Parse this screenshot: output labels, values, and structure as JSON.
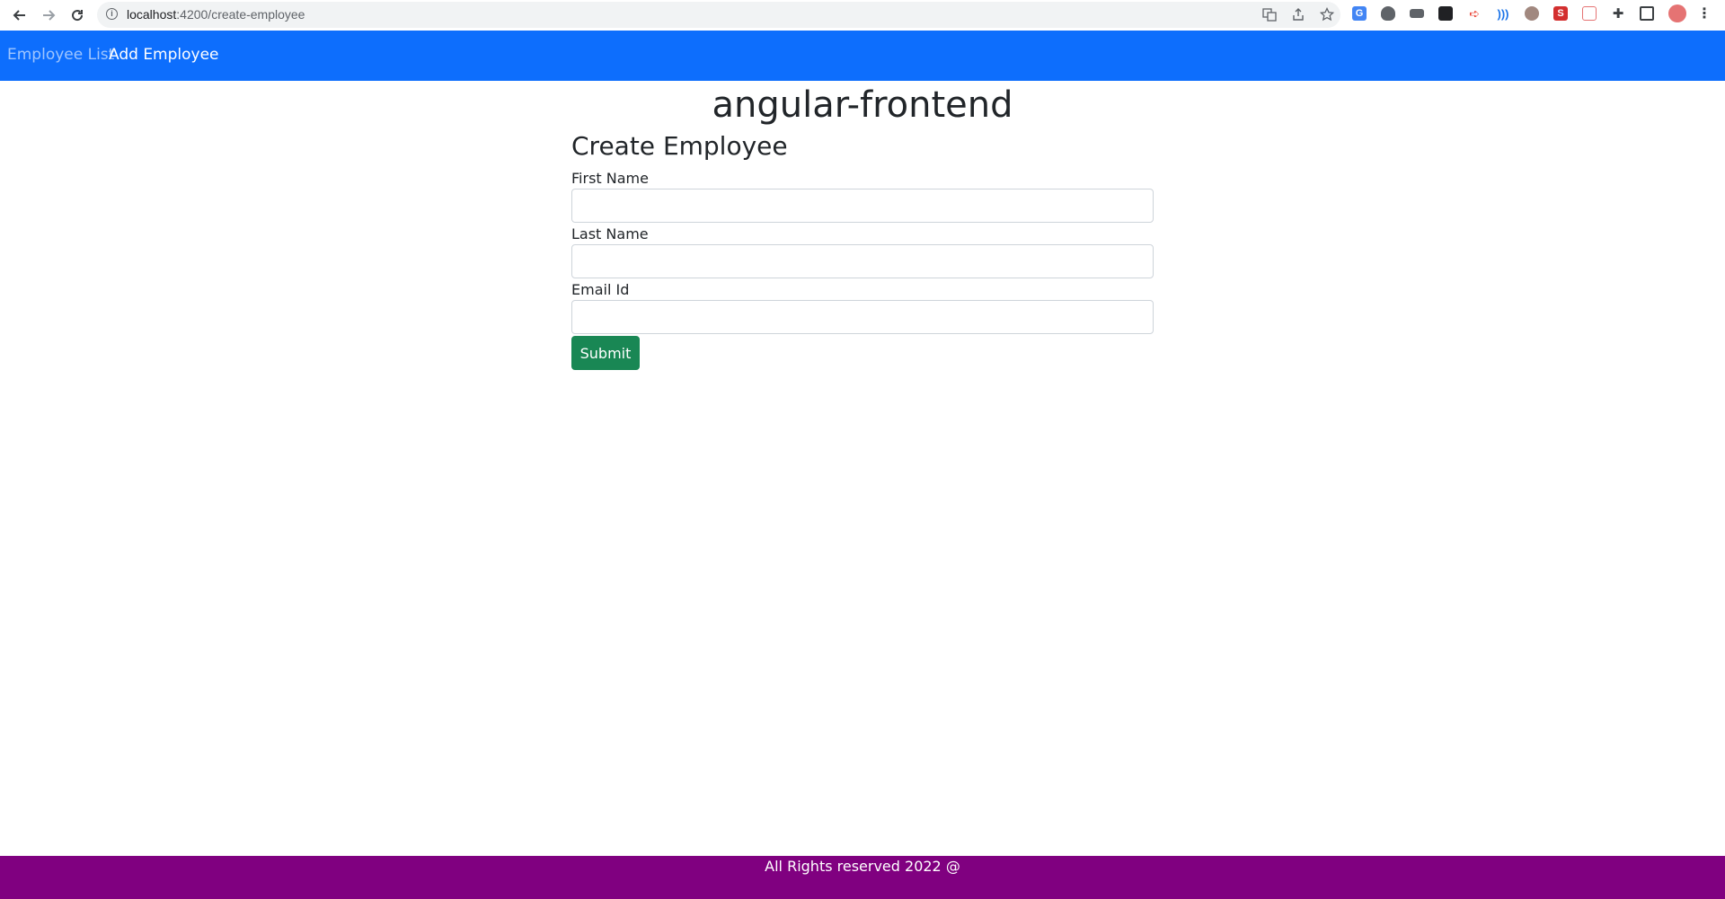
{
  "browser": {
    "url_host": "localhost",
    "url_path": ":4200/create-employee",
    "extension_icons": [
      "google-translate-icon",
      "shield-icon",
      "sneaker-icon",
      "gamepad-icon",
      "arrow-ext-icon",
      "wave-ext-icon",
      "face-ext-icon",
      "s-ext-icon",
      "calendar-ext-icon",
      "puzzle-icon",
      "sidepanel-icon",
      "profile-avatar"
    ]
  },
  "navbar": {
    "items": [
      {
        "label": "Employee List"
      },
      {
        "label": "Add Employee"
      }
    ],
    "color": "#0d6efd"
  },
  "app": {
    "title": "angular-frontend"
  },
  "form": {
    "title": "Create Employee",
    "fields": [
      {
        "label": "First Name",
        "value": ""
      },
      {
        "label": "Last Name",
        "value": ""
      },
      {
        "label": "Email Id",
        "value": ""
      }
    ],
    "submit_label": "Submit",
    "submit_color": "#198754"
  },
  "footer": {
    "text": "All Rights reserved 2022 @",
    "color": "#800080"
  }
}
